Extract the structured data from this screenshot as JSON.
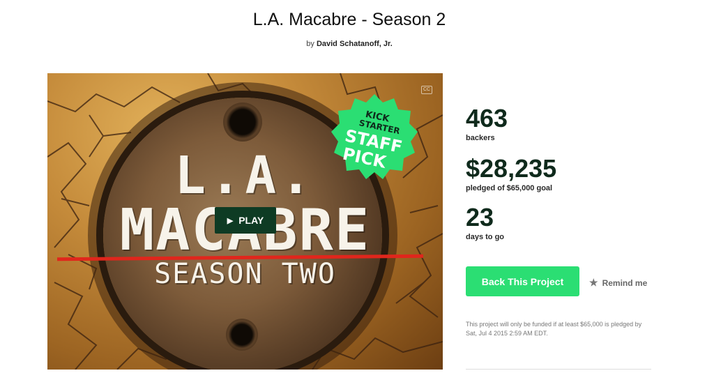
{
  "project": {
    "title": "L.A. Macabre - Season 2",
    "by_prefix": "by",
    "creator": "David Schatanoff, Jr."
  },
  "video": {
    "title_line1": "L.A.",
    "title_line2": "MACABRE",
    "title_line3": "SEASON TWO",
    "play_label": "PLAY",
    "play_icon": "play-triangle",
    "cc_label": "CC",
    "badge": {
      "line1": "KICK",
      "line2": "STARTER",
      "line3": "STAFF",
      "line4": "PICK",
      "color": "#2bde73"
    }
  },
  "stats": {
    "backers_value": "463",
    "backers_label": "backers",
    "pledged_value": "$28,235",
    "pledged_label": "pledged of $65,000 goal",
    "days_value": "23",
    "days_label": "days to go"
  },
  "actions": {
    "back_label": "Back This Project",
    "back_color": "#2bde73",
    "remind_label": "Remind me",
    "remind_icon": "star"
  },
  "funding_note": "This project will only be funded if at least $65,000 is pledged by Sat, Jul 4 2015 2:59 AM EDT."
}
